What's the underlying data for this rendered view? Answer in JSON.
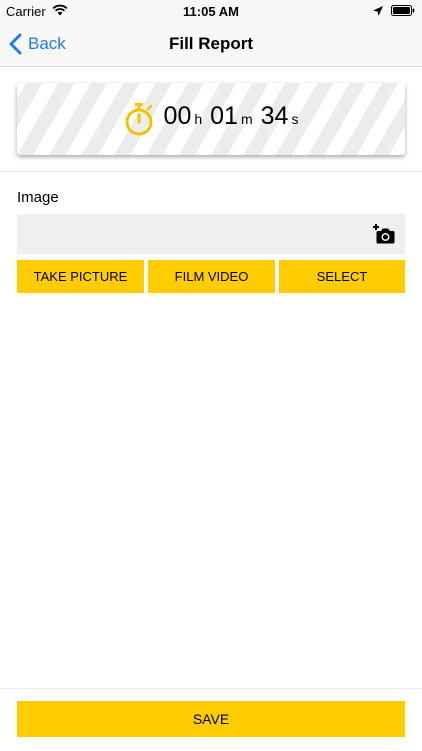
{
  "status_bar": {
    "carrier": "Carrier",
    "time": "11:05 AM",
    "icons": [
      "wifi-icon",
      "location-arrow-icon",
      "battery-icon"
    ]
  },
  "nav": {
    "back_label": "Back",
    "title": "Fill Report",
    "back_icon": "chevron-left-icon"
  },
  "timer": {
    "icon": "stopwatch-icon",
    "hours": "00",
    "hours_unit": "h",
    "minutes": "01",
    "minutes_unit": "m",
    "seconds": "34",
    "seconds_unit": "s"
  },
  "image_section": {
    "label": "Image",
    "field_icon": "add-photo-camera-icon",
    "buttons": {
      "take_picture": "TAKE PICTURE",
      "film_video": "FILM VIDEO",
      "select": "SELECT"
    }
  },
  "footer": {
    "save_label": "SAVE"
  },
  "colors": {
    "accent_yellow": "#ffcc00",
    "link_blue": "#1e7cf2",
    "stopwatch_yellow": "#f2c200"
  }
}
